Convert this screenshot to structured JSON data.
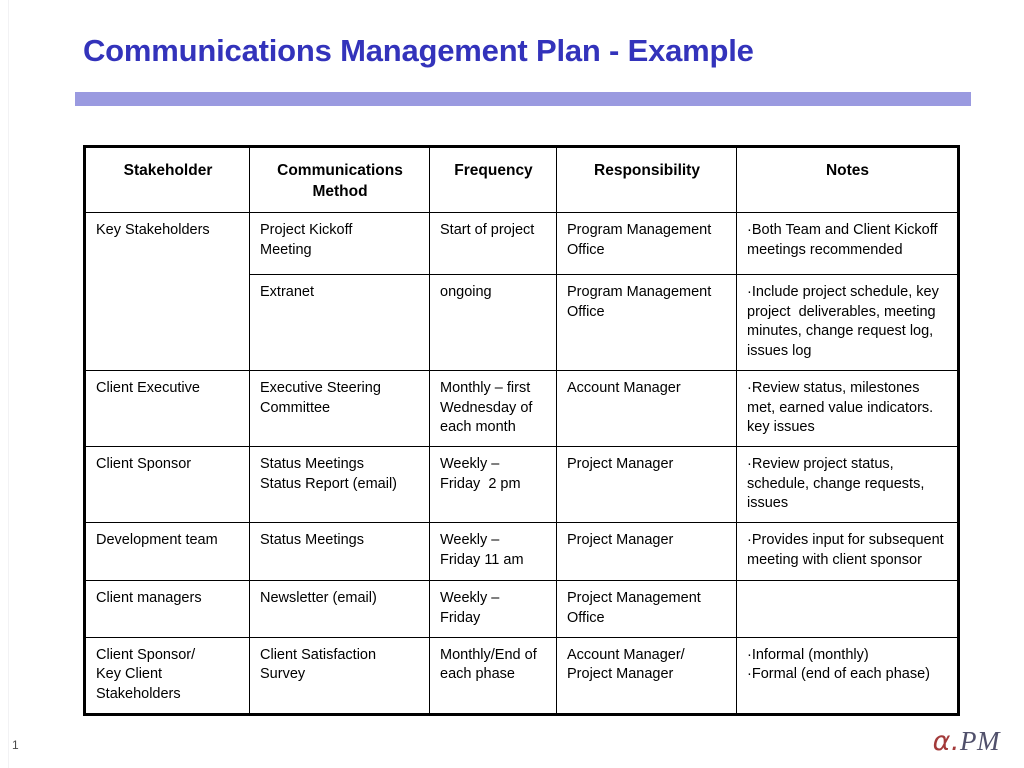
{
  "slide": {
    "title": "Communications Management Plan - Example",
    "page_number": "1",
    "accent_bar_color": "#9a9ae0",
    "title_color": "#3333bb"
  },
  "logo": {
    "alpha": "α.",
    "pm": "PM",
    "alpha_color": "#a33a3a",
    "pm_color": "#50506b"
  },
  "table": {
    "headers": [
      "Stakeholder",
      "Communications Method",
      "Frequency",
      "Responsibility",
      "Notes"
    ],
    "header_lines": {
      "h0": [
        "Stakeholder"
      ],
      "h1": [
        "Communications",
        "Method"
      ],
      "h2": [
        "Frequency"
      ],
      "h3": [
        "Responsibility"
      ],
      "h4": [
        "Notes"
      ]
    },
    "rows": [
      {
        "stakeholder": [
          "Key Stakeholders"
        ],
        "method": [
          "Project Kickoff",
          "Meeting"
        ],
        "frequency": [
          "Start of project"
        ],
        "responsibility": [
          "Program Management",
          "Office"
        ],
        "notes_bullets": [
          "Both Team and Client Kickoff meetings recommended"
        ]
      },
      {
        "stakeholder": [],
        "method": [
          "Extranet"
        ],
        "frequency": [
          "ongoing"
        ],
        "responsibility": [
          "Program Management",
          "Office"
        ],
        "notes_bullets": [
          "Include project schedule, key project  deliverables, meeting minutes, change request log, issues log"
        ]
      },
      {
        "stakeholder": [
          "Client Executive"
        ],
        "method": [
          "Executive Steering",
          "Committee"
        ],
        "frequency": [
          "Monthly – first",
          "Wednesday of",
          "each month"
        ],
        "responsibility": [
          "Account Manager"
        ],
        "notes_bullets": [
          "Review status, milestones met, earned value indicators. key issues"
        ]
      },
      {
        "stakeholder": [
          "Client Sponsor"
        ],
        "method": [
          "Status Meetings",
          "Status Report (email)"
        ],
        "frequency": [
          "Weekly –",
          "Friday  2 pm"
        ],
        "responsibility": [
          "Project Manager"
        ],
        "notes_bullets": [
          "Review project status, schedule, change requests, issues"
        ]
      },
      {
        "stakeholder": [
          "Development team"
        ],
        "method": [
          "Status Meetings"
        ],
        "frequency": [
          "Weekly –",
          "Friday 11 am"
        ],
        "responsibility": [
          "Project Manager"
        ],
        "notes_bullets": [
          "Provides input for subsequent meeting with client sponsor"
        ]
      },
      {
        "stakeholder": [
          "Client managers"
        ],
        "method": [
          "Newsletter (email)"
        ],
        "frequency": [
          "Weekly –",
          "Friday"
        ],
        "responsibility": [
          "Project Management",
          "Office"
        ],
        "notes_bullets": []
      },
      {
        "stakeholder": [
          "Client Sponsor/",
          "Key Client",
          "Stakeholders"
        ],
        "method": [
          "Client Satisfaction",
          "Survey"
        ],
        "frequency": [
          "Monthly/End of",
          "each phase"
        ],
        "responsibility": [
          "Account Manager/",
          "Project Manager"
        ],
        "notes_bullets": [
          "Informal (monthly)",
          "Formal (end of each phase)"
        ]
      }
    ]
  }
}
